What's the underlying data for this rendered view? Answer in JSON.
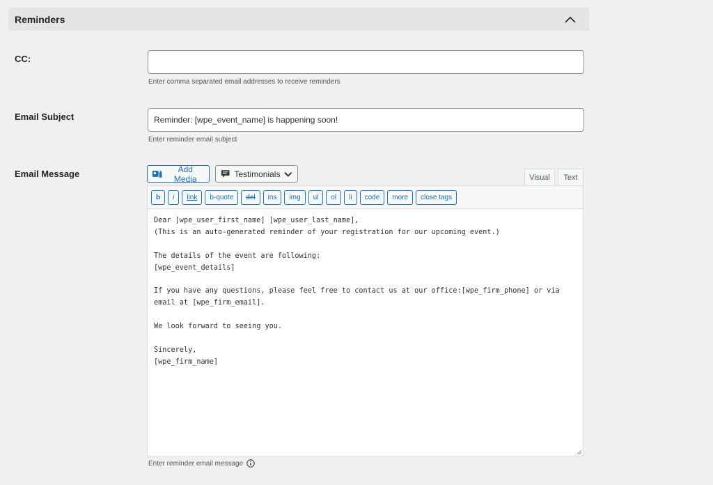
{
  "panel": {
    "title": "Reminders"
  },
  "cc": {
    "label": "CC:",
    "value": "",
    "placeholder": "",
    "description": "Enter comma separated email addresses to receive reminders"
  },
  "subject": {
    "label": "Email Subject",
    "value": "Reminder: [wpe_event_name] is happening soon!",
    "description": "Enter reminder email subject"
  },
  "message": {
    "label": "Email Message",
    "add_media_label": "Add Media",
    "shortcode_select_label": "Testimonials",
    "tabs": {
      "visual": "Visual",
      "text": "Text"
    },
    "active_tab": "Text",
    "quicktags": [
      "b",
      "i",
      "link",
      "b-quote",
      "del",
      "ins",
      "img",
      "ul",
      "ol",
      "li",
      "code",
      "more",
      "close tags"
    ],
    "content": "Dear [wpe_user_first_name] [wpe_user_last_name],\n(This is an auto-generated reminder of your registration for our upcoming event.)\n\nThe details of the event are following:\n[wpe_event_details]\n\nIf you have any questions, please feel free to contact us at our office:[wpe_firm_phone] or via email at [wpe_firm_email].\n\nWe look forward to seeing you.\n\nSincerely,\n[wpe_firm_name]",
    "description": "Enter reminder email message"
  },
  "icons": {
    "collapse": "chevron-up-icon",
    "media": "add-media-icon",
    "select": "testimonial-icon",
    "dropdown": "chevron-down-icon",
    "info": "info-icon"
  },
  "colors": {
    "accent": "#2271b1",
    "background": "#f0f0f1",
    "header": "#e4e4e5"
  }
}
